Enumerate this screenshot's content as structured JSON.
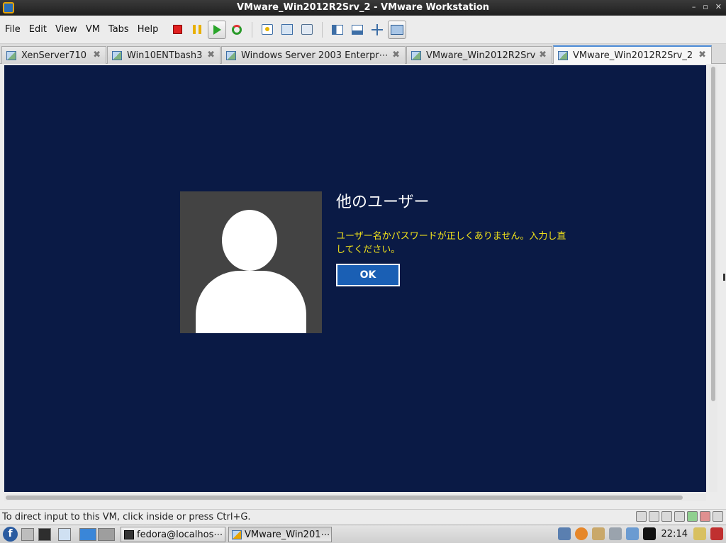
{
  "window": {
    "title": "VMware_Win2012R2Srv_2 - VMware Workstation"
  },
  "menu": [
    "File",
    "Edit",
    "View",
    "VM",
    "Tabs",
    "Help"
  ],
  "toolbar": [
    "stop-icon",
    "pause-icon",
    "play-icon",
    "restart-icon",
    "snapshot-icon",
    "revert-snapshot-icon",
    "snapshot-manager-icon",
    "library-view-icon",
    "console-view-icon",
    "fit-guest-icon",
    "full-screen-icon"
  ],
  "tabs": [
    {
      "label": "XenServer710"
    },
    {
      "label": "Win10ENTbash3"
    },
    {
      "label": "Windows Server 2003 Enterpr⋯"
    },
    {
      "label": "VMware_Win2012R2Srv"
    },
    {
      "label": "VMware_Win2012R2Srv_2"
    }
  ],
  "active_tab": "VMware_Win2012R2Srv_2",
  "guest": {
    "user_title": "他のユーザー",
    "error_message": "ユーザー名かパスワードが正しくありません。入力し直してください。",
    "ok_label": "OK"
  },
  "statusbar": {
    "hint": "To direct input to this VM, click inside or press Ctrl+G."
  },
  "taskbar": {
    "tasks": [
      {
        "label": "fedora@localhos⋯"
      },
      {
        "label": "VMware_Win201⋯"
      }
    ],
    "clock": "22:14"
  },
  "colors": {
    "vm_background": "#0a1a45",
    "error_text": "#f2e31a",
    "ok_button": "#1a5fb4"
  }
}
